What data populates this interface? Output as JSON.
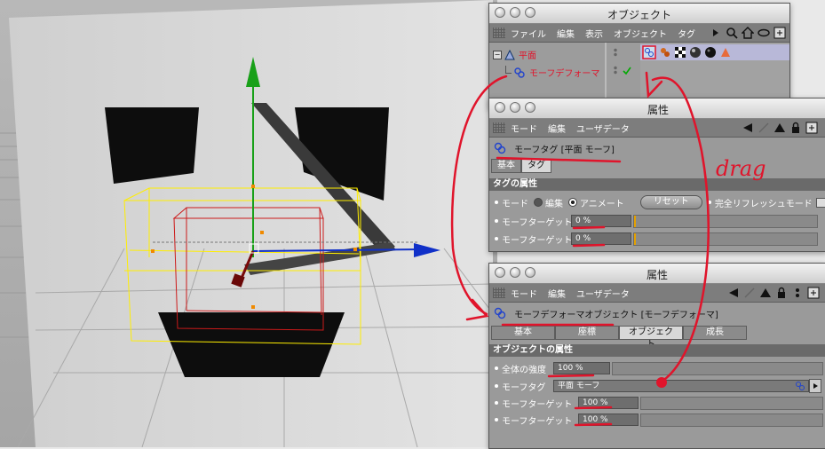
{
  "object_window": {
    "title": "オブジェクト",
    "menu": [
      "ファイル",
      "編集",
      "表示",
      "オブジェクト",
      "タグ"
    ],
    "tree": [
      {
        "label": "平面"
      },
      {
        "label": "モーフデフォーマ"
      }
    ]
  },
  "attr_window_1": {
    "title": "属性",
    "menu": [
      "モード",
      "編集",
      "ユーザデータ"
    ],
    "header": "モーフタグ [平面 モーフ]",
    "tabs": [
      "基本",
      "タグ"
    ],
    "section": "タグの属性",
    "mode_label": "モード",
    "mode_option_edit": "編集",
    "mode_option_animate": "アニメート",
    "reset_button": "リセット",
    "relax_label": "完全リフレッシュモード",
    "morph_target_1_label": "モーフターゲット",
    "morph_target_1_value": "0 %",
    "morph_target_2_label": "モーフターゲット",
    "morph_target_2_value": "0 %"
  },
  "attr_window_2": {
    "title": "属性",
    "menu": [
      "モード",
      "編集",
      "ユーザデータ"
    ],
    "header": "モーフデフォーマオブジェクト [モーフデフォーマ]",
    "tabs": [
      "基本",
      "座標",
      "オブジェクト",
      "成長"
    ],
    "section": "オブジェクトの属性",
    "strength_label": "全体の強度",
    "strength_value": "100 %",
    "morph_tag_label": "モーフタグ",
    "morph_tag_value": "平面 モーフ",
    "target_1_label": "モーフターゲット",
    "target_1_value": "100 %",
    "target_2_label": "モーフターゲット",
    "target_2_value": "100 %"
  },
  "annotation": {
    "text": "drag",
    "color": "#e0142b"
  },
  "colors": {
    "axis_x": "#1030c8",
    "axis_y": "#18a018",
    "bbox": "#ffee00",
    "deformer": "#cc1a1a"
  }
}
